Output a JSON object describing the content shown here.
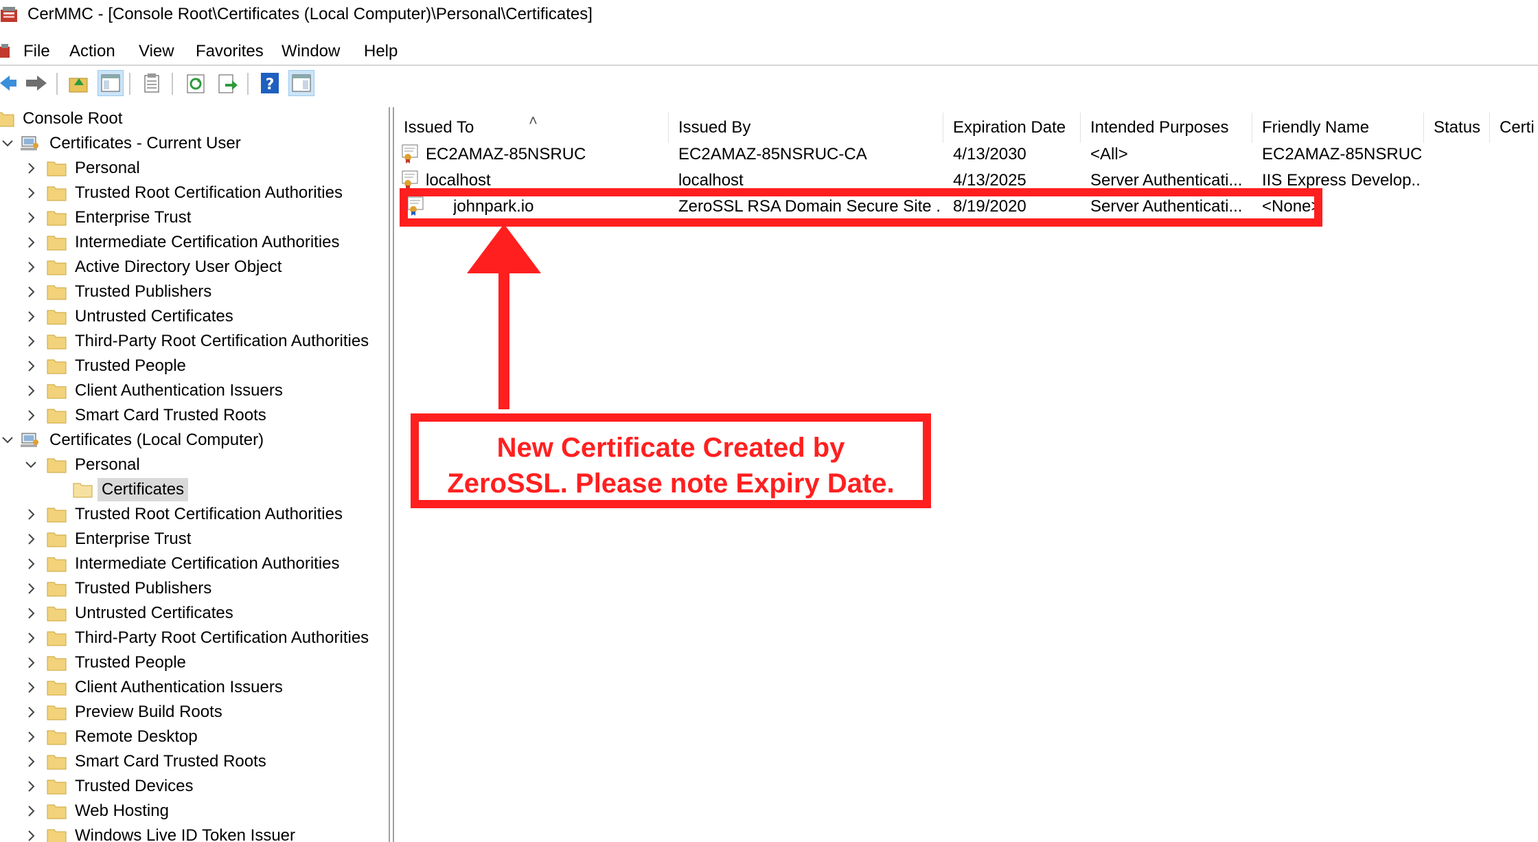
{
  "window": {
    "title": "CerMMC - [Console Root\\Certificates (Local Computer)\\Personal\\Certificates]"
  },
  "menubar": {
    "items": [
      "File",
      "Action",
      "View",
      "Favorites",
      "Window",
      "Help"
    ]
  },
  "toolbar": {
    "buttons": [
      "back-arrow-icon",
      "forward-arrow-icon",
      "up-folder-icon",
      "show-hide-tree-icon",
      "properties-icon",
      "refresh-icon",
      "export-list-icon",
      "help-icon",
      "action-pane-icon"
    ]
  },
  "tree": {
    "root": "Console Root",
    "current_user": {
      "label": "Certificates - Current User",
      "children": [
        "Personal",
        "Trusted Root Certification Authorities",
        "Enterprise Trust",
        "Intermediate Certification Authorities",
        "Active Directory User Object",
        "Trusted Publishers",
        "Untrusted Certificates",
        "Third-Party Root Certification Authorities",
        "Trusted People",
        "Client Authentication Issuers",
        "Smart Card Trusted Roots"
      ]
    },
    "local_computer": {
      "label": "Certificates (Local Computer)",
      "personal": "Personal",
      "personal_child": "Certificates",
      "children": [
        "Trusted Root Certification Authorities",
        "Enterprise Trust",
        "Intermediate Certification Authorities",
        "Trusted Publishers",
        "Untrusted Certificates",
        "Third-Party Root Certification Authorities",
        "Trusted People",
        "Client Authentication Issuers",
        "Preview Build Roots",
        "Remote Desktop",
        "Smart Card Trusted Roots",
        "Trusted Devices",
        "Web Hosting",
        "Windows Live ID Token Issuer"
      ]
    }
  },
  "list": {
    "columns": [
      "Issued To",
      "Issued By",
      "Expiration Date",
      "Intended Purposes",
      "Friendly Name",
      "Status",
      "Certi"
    ],
    "rows": [
      {
        "issued_to": "EC2AMAZ-85NSRUC",
        "issued_by": "EC2AMAZ-85NSRUC-CA",
        "expiration": "4/13/2030",
        "purposes": "<All>",
        "friendly": "EC2AMAZ-85NSRUC",
        "status": ""
      },
      {
        "issued_to": "localhost",
        "issued_by": "localhost",
        "expiration": "4/13/2025",
        "purposes": "Server Authenticati...",
        "friendly": "IIS Express Develop...",
        "status": ""
      },
      {
        "issued_to": "johnpark.io",
        "issued_by": "ZeroSSL RSA Domain Secure Site ...",
        "expiration": "8/19/2020",
        "purposes": "Server Authenticati...",
        "friendly": "<None>",
        "status": ""
      }
    ]
  },
  "annotation": {
    "line1": "New Certificate Created by",
    "line2": "ZeroSSL.  Please note Expiry Date.",
    "color": "#ff1f1f"
  }
}
